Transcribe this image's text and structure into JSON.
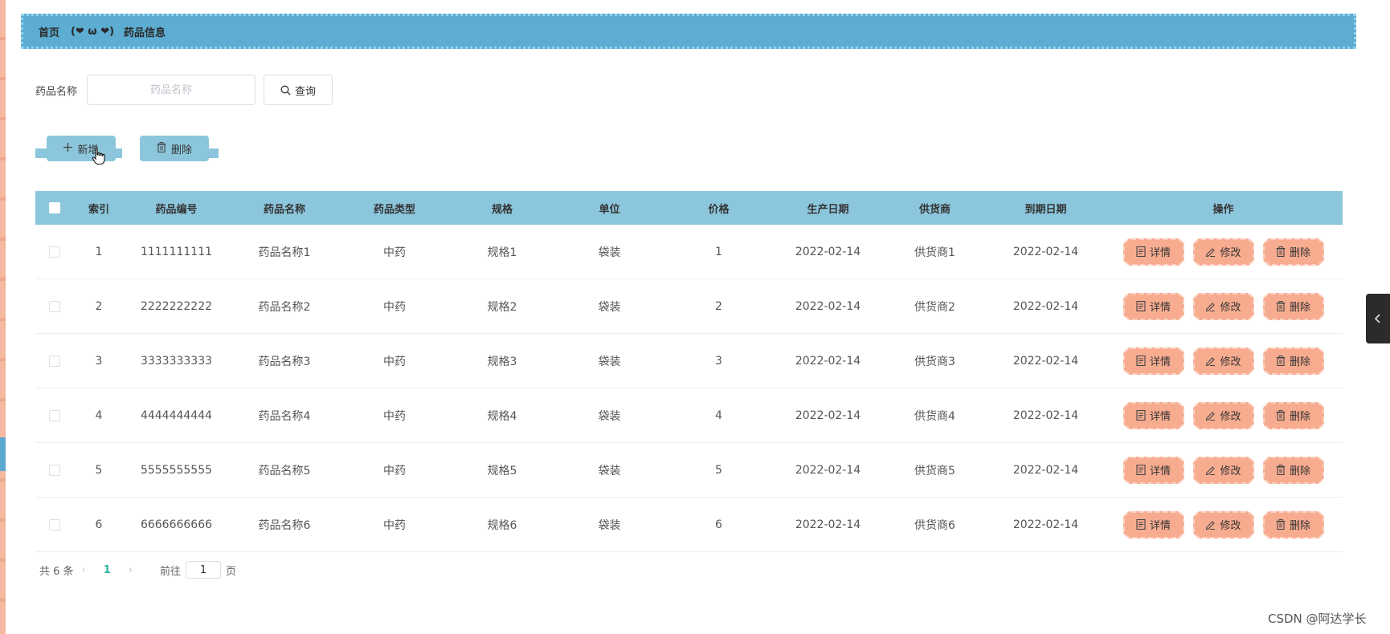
{
  "breadcrumb": {
    "home": "首页",
    "separator": "(❤ ω ❤)",
    "current": "药品信息"
  },
  "search": {
    "label": "药品名称",
    "placeholder": "药品名称",
    "value": "",
    "query_label": "查询"
  },
  "actions": {
    "add_label": "新增",
    "delete_label": "删除"
  },
  "table": {
    "headers": [
      "索引",
      "药品编号",
      "药品名称",
      "药品类型",
      "规格",
      "单位",
      "价格",
      "生产日期",
      "供货商",
      "到期日期",
      "操作"
    ],
    "rows": [
      {
        "index": "1",
        "code": "1111111111",
        "name": "药品名称1",
        "type": "中药",
        "spec": "规格1",
        "unit": "袋装",
        "price": "1",
        "produced": "2022-02-14",
        "supplier": "供货商1",
        "expires": "2022-02-14"
      },
      {
        "index": "2",
        "code": "2222222222",
        "name": "药品名称2",
        "type": "中药",
        "spec": "规格2",
        "unit": "袋装",
        "price": "2",
        "produced": "2022-02-14",
        "supplier": "供货商2",
        "expires": "2022-02-14"
      },
      {
        "index": "3",
        "code": "3333333333",
        "name": "药品名称3",
        "type": "中药",
        "spec": "规格3",
        "unit": "袋装",
        "price": "3",
        "produced": "2022-02-14",
        "supplier": "供货商3",
        "expires": "2022-02-14"
      },
      {
        "index": "4",
        "code": "4444444444",
        "name": "药品名称4",
        "type": "中药",
        "spec": "规格4",
        "unit": "袋装",
        "price": "4",
        "produced": "2022-02-14",
        "supplier": "供货商4",
        "expires": "2022-02-14"
      },
      {
        "index": "5",
        "code": "5555555555",
        "name": "药品名称5",
        "type": "中药",
        "spec": "规格5",
        "unit": "袋装",
        "price": "5",
        "produced": "2022-02-14",
        "supplier": "供货商5",
        "expires": "2022-02-14"
      },
      {
        "index": "6",
        "code": "6666666666",
        "name": "药品名称6",
        "type": "中药",
        "spec": "规格6",
        "unit": "袋装",
        "price": "6",
        "produced": "2022-02-14",
        "supplier": "供货商6",
        "expires": "2022-02-14"
      }
    ],
    "row_actions": {
      "detail": "详情",
      "edit": "修改",
      "delete": "删除"
    }
  },
  "pagination": {
    "total": "共 6 条",
    "current_page": "1",
    "goto_prefix": "前往",
    "goto_value": "1",
    "goto_suffix": "页"
  },
  "watermark": "CSDN @阿达学长",
  "colors": {
    "header_bar": "#5dadd2",
    "table_header": "#8cc6dc",
    "action_button": "#f7ac90",
    "sidebar_strip": "#f6b8a0",
    "page_active": "#29b4a0"
  },
  "icons": {
    "query": "search-icon",
    "add": "plus-icon",
    "delete": "trash-icon",
    "detail": "document-icon",
    "edit": "pencil-icon",
    "side_tab": "chevron-left-icon"
  }
}
